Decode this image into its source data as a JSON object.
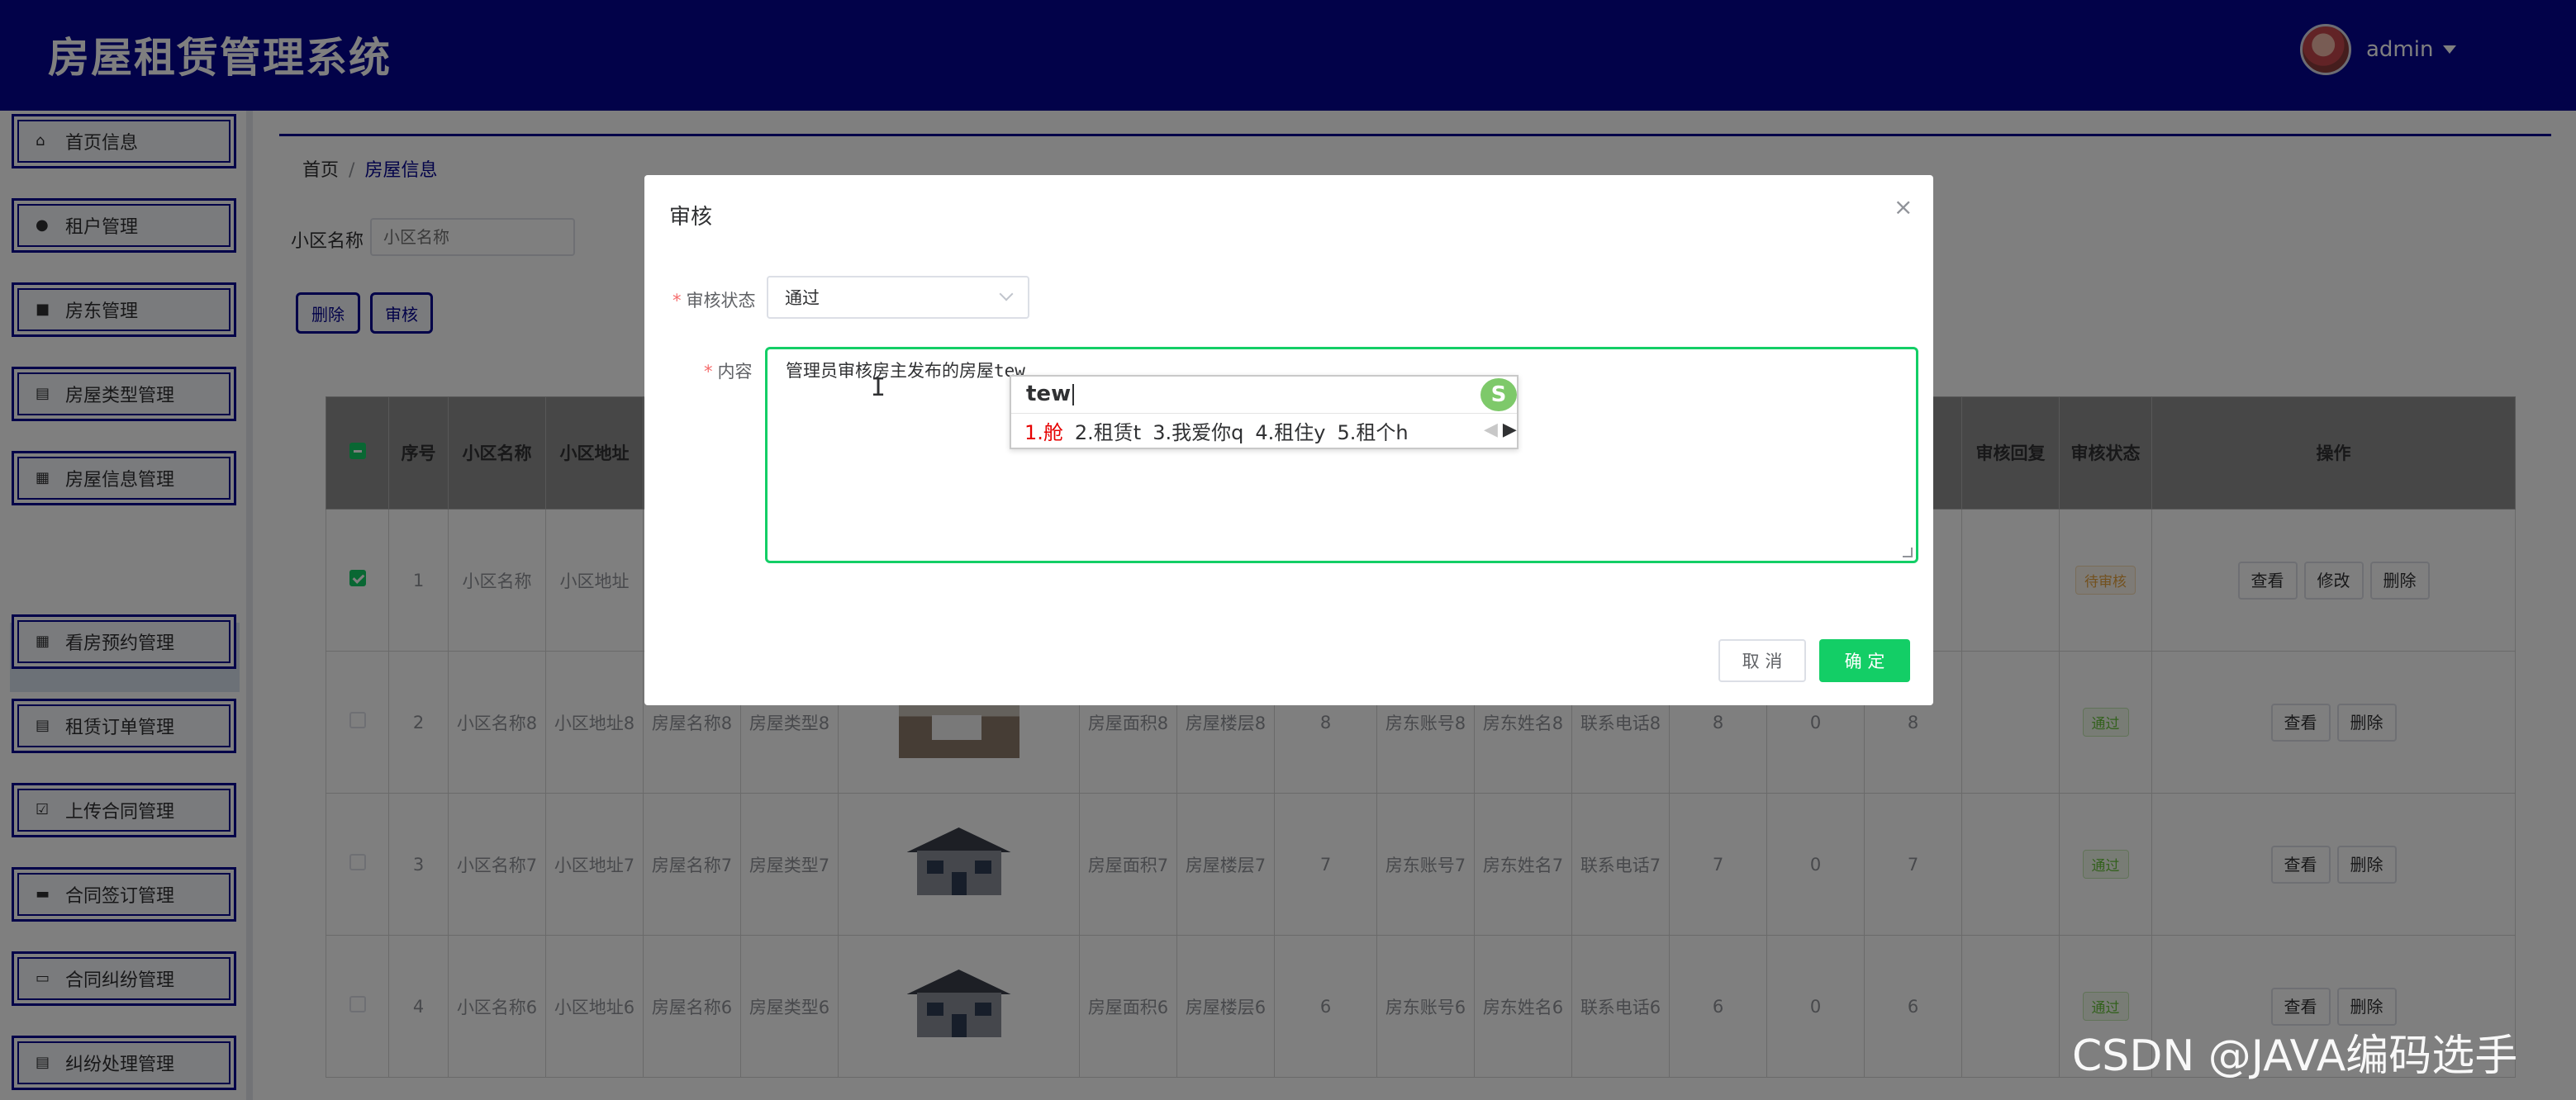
{
  "header": {
    "title": "房屋租赁管理系统",
    "username": "admin"
  },
  "sidebar": {
    "items": [
      {
        "label": "首页信息",
        "icon": "home-icon"
      },
      {
        "label": "租户管理",
        "icon": "location-pin-icon"
      },
      {
        "label": "房东管理",
        "icon": "briefcase-icon"
      },
      {
        "label": "房屋类型管理",
        "icon": "clipboard-icon"
      },
      {
        "label": "房屋信息管理",
        "icon": "grid-icon"
      },
      {
        "label": "看房预约管理",
        "icon": "grid-icon"
      },
      {
        "label": "租赁订单管理",
        "icon": "document-icon"
      },
      {
        "label": "上传合同管理",
        "icon": "checklist-icon"
      },
      {
        "label": "合同签订管理",
        "icon": "printer-icon"
      },
      {
        "label": "合同纠纷管理",
        "icon": "monitor-icon"
      },
      {
        "label": "纠纷处理管理",
        "icon": "archive-icon"
      }
    ],
    "submenu_label": "房屋信息"
  },
  "breadcrumb": {
    "home": "首页",
    "separator": "/",
    "current": "房屋信息"
  },
  "search": {
    "label": "小区名称",
    "placeholder": "小区名称"
  },
  "toolbar": {
    "delete_label": "删除",
    "audit_label": "审核"
  },
  "table": {
    "headers": {
      "index": "序号",
      "community_name": "小区名称",
      "community_address": "小区地址",
      "audit_reply": "审核回复",
      "audit_status": "审核状态",
      "actions": "操作"
    },
    "rows": [
      {
        "index": "1",
        "community_name": "小区名称",
        "community_address": "小区地址",
        "house_name": "",
        "house_type": "",
        "area": "",
        "floor": "",
        "c1": "",
        "landlord_account": "",
        "landlord_name": "",
        "phone": "",
        "c2": "",
        "c3": "",
        "c4": "",
        "status": "待审核",
        "actions": [
          "查看",
          "修改",
          "删除"
        ]
      },
      {
        "index": "2",
        "community_name": "小区名称8",
        "community_address": "小区地址8",
        "house_name": "房屋名称8",
        "house_type": "房屋类型8",
        "area": "房屋面积8",
        "floor": "房屋楼层8",
        "c1": "8",
        "landlord_account": "房东账号8",
        "landlord_name": "房东姓名8",
        "phone": "联系电话8",
        "c2": "8",
        "c3": "0",
        "c4": "8",
        "status": "通过",
        "actions": [
          "查看",
          "删除"
        ]
      },
      {
        "index": "3",
        "community_name": "小区名称7",
        "community_address": "小区地址7",
        "house_name": "房屋名称7",
        "house_type": "房屋类型7",
        "area": "房屋面积7",
        "floor": "房屋楼层7",
        "c1": "7",
        "landlord_account": "房东账号7",
        "landlord_name": "房东姓名7",
        "phone": "联系电话7",
        "c2": "7",
        "c3": "0",
        "c4": "7",
        "status": "通过",
        "actions": [
          "查看",
          "删除"
        ]
      },
      {
        "index": "4",
        "community_name": "小区名称6",
        "community_address": "小区地址6",
        "house_name": "房屋名称6",
        "house_type": "房屋类型6",
        "area": "房屋面积6",
        "floor": "房屋楼层6",
        "c1": "6",
        "landlord_account": "房东账号6",
        "landlord_name": "房东姓名6",
        "phone": "联系电话6",
        "c2": "6",
        "c3": "0",
        "c4": "6",
        "status": "通过",
        "actions": [
          "查看",
          "删除"
        ]
      }
    ]
  },
  "dialog": {
    "title": "审核",
    "close": "×",
    "status_label": "审核状态",
    "status_value": "通过",
    "content_label": "内容",
    "content_value": "管理员审核房主发布的房屋tew",
    "cancel_label": "取 消",
    "ok_label": "确 定"
  },
  "ime": {
    "input": "tew",
    "logo": "S",
    "candidates": [
      "1.舱",
      "2.租赁t",
      "3.我爱你q",
      "4.租住y",
      "5.租个h"
    ],
    "prev": "◀",
    "next": "▶"
  },
  "watermark": "CSDN @JAVA编码选手",
  "colors": {
    "brand": "#050593",
    "accent": "#13ce66",
    "danger": "#f56c6c"
  }
}
